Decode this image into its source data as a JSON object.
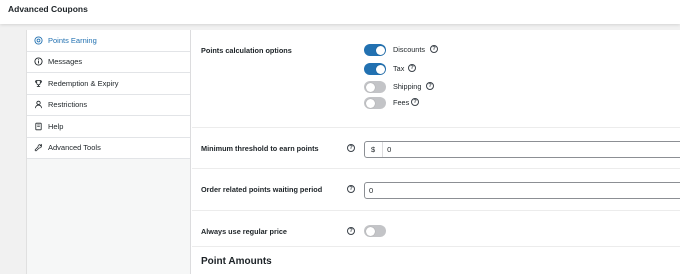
{
  "app": {
    "title": "Advanced Coupons"
  },
  "sidebar": {
    "items": [
      {
        "label": "Points Earning",
        "icon": "coin-icon",
        "active": true
      },
      {
        "label": "Messages",
        "icon": "info-icon",
        "active": false
      },
      {
        "label": "Redemption & Expiry",
        "icon": "trophy-icon",
        "active": false
      },
      {
        "label": "Restrictions",
        "icon": "user-icon",
        "active": false
      },
      {
        "label": "Help",
        "icon": "help-book-icon",
        "active": false
      },
      {
        "label": "Advanced Tools",
        "icon": "wrench-icon",
        "active": false
      }
    ]
  },
  "settings": {
    "points_calc": {
      "label": "Points calculation options",
      "options": [
        {
          "label": "Discounts",
          "enabled": true
        },
        {
          "label": "Tax",
          "enabled": true
        },
        {
          "label": "Shipping",
          "enabled": false
        },
        {
          "label": "Fees",
          "enabled": false
        }
      ]
    },
    "min_threshold": {
      "label": "Minimum threshold to earn points",
      "prefix": "$",
      "value": "0"
    },
    "waiting_period": {
      "label": "Order related points waiting period",
      "value": "0"
    },
    "regular_price": {
      "label": "Always use regular price",
      "enabled": false
    },
    "section_heading": "Point Amounts"
  },
  "colors": {
    "accent": "#2271b1",
    "toggle_off": "#c3c4c7"
  }
}
